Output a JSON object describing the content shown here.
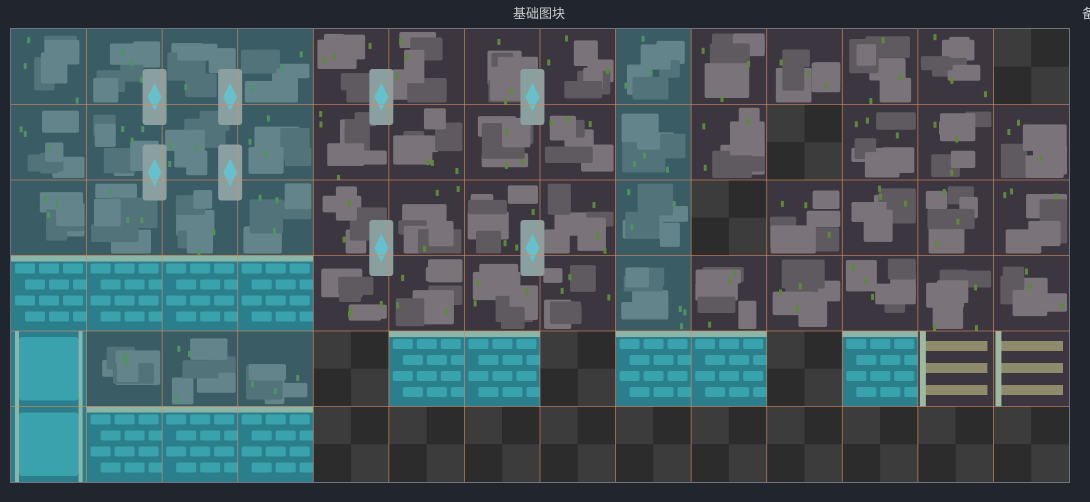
{
  "panel": {
    "title": "基础图块",
    "side_label": "备"
  },
  "tileset": {
    "columns": 14,
    "rows": 6,
    "colors": {
      "stone": "#5f5a5f",
      "stone_light": "#7a7379",
      "mortar": "#3b3640",
      "moss": "#5d8a3a",
      "water": "#3aa2ad",
      "water_deep": "#2b7f8c",
      "rim": "#8ab5a7",
      "grid": "#d98b5a",
      "checker_a": "#2c2c2c",
      "checker_b": "#3c3c3c",
      "crystal": "#67c1cc"
    },
    "tiles": [
      [
        "w_stone",
        "w_stone",
        "w_stone",
        "w_stone",
        "stone",
        "stone",
        "stone",
        "stone",
        "w_stone",
        "stone",
        "stone",
        "stone",
        "stone",
        "empty"
      ],
      [
        "w_stone",
        "w_stone",
        "w_stone",
        "w_stone",
        "stone",
        "stone",
        "stone",
        "stone",
        "w_stone",
        "stone",
        "empty",
        "stone",
        "stone",
        "stone"
      ],
      [
        "w_stone",
        "w_stone",
        "w_stone",
        "w_stone",
        "stone",
        "stone",
        "stone",
        "stone",
        "w_stone",
        "empty",
        "stone",
        "stone",
        "stone",
        "stone"
      ],
      [
        "water",
        "water",
        "water",
        "water",
        "stone",
        "stone",
        "stone",
        "stone",
        "w_stone",
        "stone",
        "stone",
        "stone",
        "stone",
        "stone"
      ],
      [
        "pool",
        "w_stone",
        "w_stone",
        "w_stone",
        "empty",
        "water",
        "water",
        "empty",
        "water",
        "water",
        "empty",
        "water",
        "ladder",
        "ladder"
      ],
      [
        "pool",
        "water",
        "water",
        "water",
        "empty",
        "empty",
        "empty",
        "empty",
        "empty",
        "empty",
        "empty",
        "empty",
        "empty",
        "empty"
      ]
    ],
    "crystals": [
      {
        "col": 1.9,
        "row": 0.9
      },
      {
        "col": 2.9,
        "row": 0.9
      },
      {
        "col": 1.9,
        "row": 1.9
      },
      {
        "col": 2.9,
        "row": 1.9
      },
      {
        "col": 4.9,
        "row": 0.9
      },
      {
        "col": 4.9,
        "row": 2.9
      },
      {
        "col": 6.9,
        "row": 0.9
      },
      {
        "col": 6.9,
        "row": 2.9
      }
    ]
  }
}
